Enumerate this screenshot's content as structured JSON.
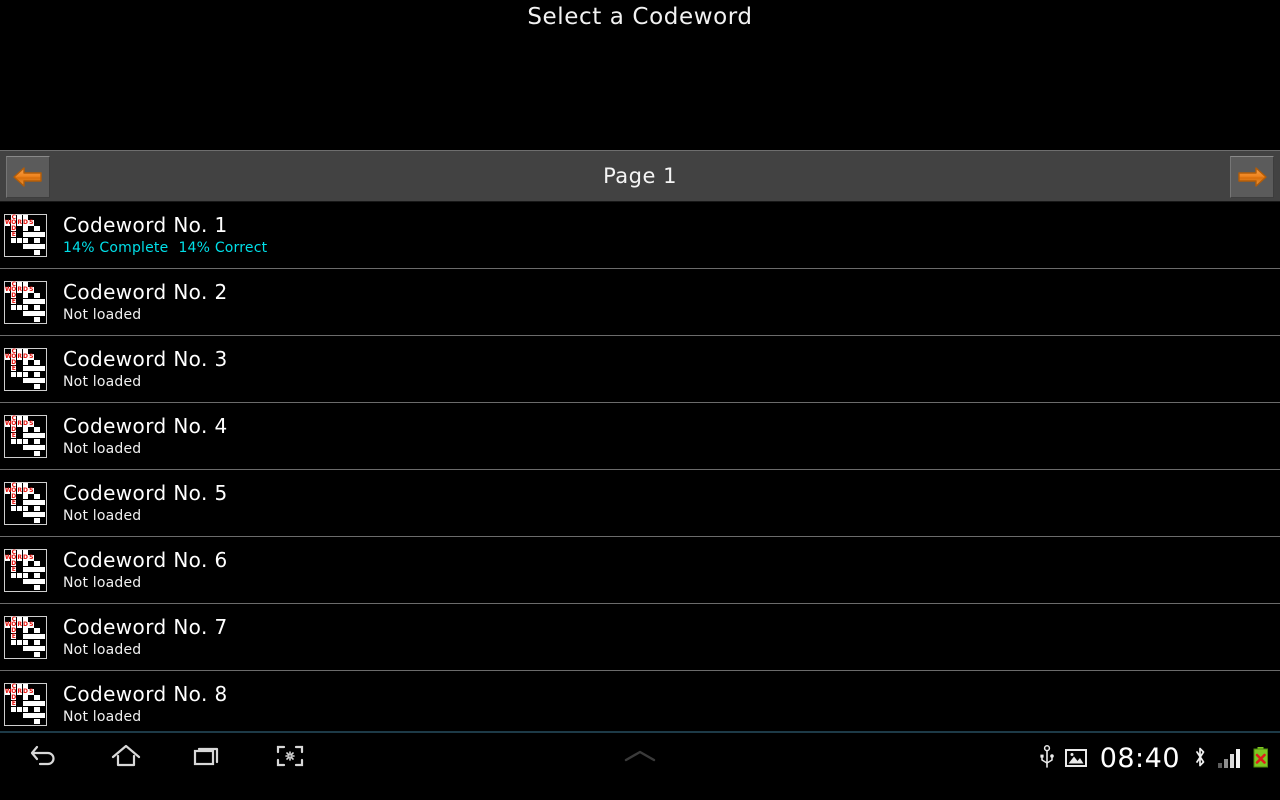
{
  "app": {
    "title": "Select a Codeword"
  },
  "pager": {
    "label": "Page 1",
    "prev_icon": "arrow-left-icon",
    "next_icon": "arrow-right-icon",
    "accent_color": "#e87d1e",
    "bar_color": "#424242"
  },
  "list": {
    "thumbnail_icon": "crossword-grid-icon",
    "thumbnail_letters_across": "WORDS",
    "thumbnail_letters_down": "CODE",
    "items": [
      {
        "title": "Codeword No. 1",
        "status": "14% Complete",
        "status2": "14% Correct",
        "state": "progress"
      },
      {
        "title": "Codeword No. 2",
        "status": "Not loaded",
        "status2": "",
        "state": "notloaded"
      },
      {
        "title": "Codeword No. 3",
        "status": "Not loaded",
        "status2": "",
        "state": "notloaded"
      },
      {
        "title": "Codeword No. 4",
        "status": "Not loaded",
        "status2": "",
        "state": "notloaded"
      },
      {
        "title": "Codeword No. 5",
        "status": "Not loaded",
        "status2": "",
        "state": "notloaded"
      },
      {
        "title": "Codeword No. 6",
        "status": "Not loaded",
        "status2": "",
        "state": "notloaded"
      },
      {
        "title": "Codeword No. 7",
        "status": "Not loaded",
        "status2": "",
        "state": "notloaded"
      },
      {
        "title": "Codeword No. 8",
        "status": "Not loaded",
        "status2": "",
        "state": "notloaded"
      }
    ],
    "progress_color": "#00dfe8"
  },
  "systembar": {
    "nav": [
      {
        "name": "back-icon"
      },
      {
        "name": "home-icon"
      },
      {
        "name": "recents-icon"
      },
      {
        "name": "screenshot-icon"
      }
    ],
    "center_icon": "chevron-up-icon",
    "status": {
      "usb_icon": "usb-icon",
      "image_icon": "image-icon",
      "clock": "08:40",
      "bluetooth_icon": "bluetooth-icon",
      "signal_icon": "signal-bars-icon",
      "battery_icon": "battery-error-icon",
      "battery_color": "#7ec820"
    }
  }
}
